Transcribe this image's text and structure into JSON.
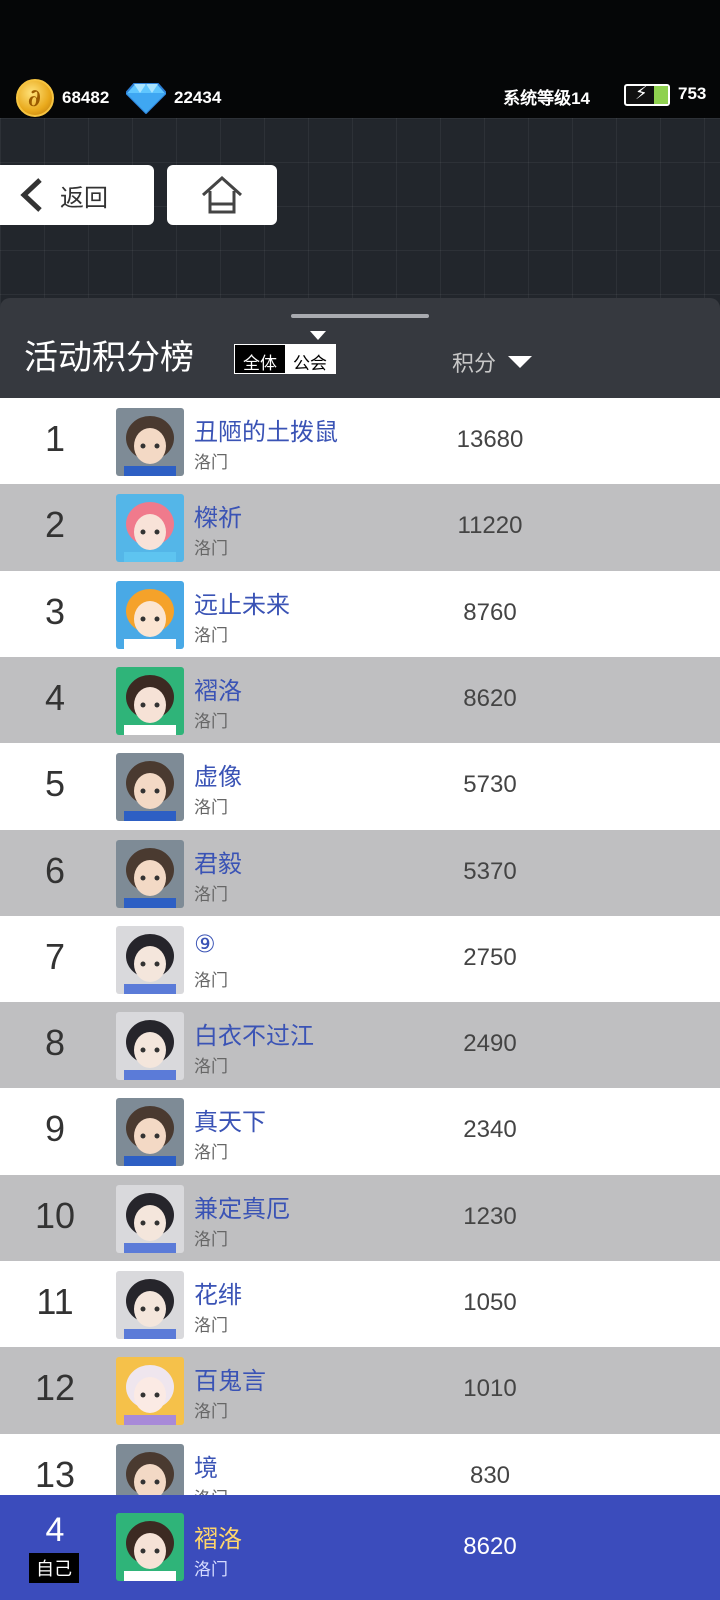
{
  "resources": {
    "coins": "68482",
    "gems": "22434",
    "system_level": "系统等级14",
    "stamina": "753"
  },
  "nav": {
    "back_label": "返回"
  },
  "board": {
    "title": "活动积分榜",
    "filter_all": "全体",
    "filter_guild": "公会",
    "score_header": "积分"
  },
  "rows": [
    {
      "rank": "1",
      "name": "丑陋的土拨鼠",
      "guild": "洛门",
      "score": "13680",
      "avatar": "boy"
    },
    {
      "rank": "2",
      "name": "榤祈",
      "guild": "洛门",
      "score": "11220",
      "avatar": "pink"
    },
    {
      "rank": "3",
      "name": "远止未来",
      "guild": "洛门",
      "score": "8760",
      "avatar": "orange"
    },
    {
      "rank": "4",
      "name": "褶洛",
      "guild": "洛门",
      "score": "8620",
      "avatar": "green"
    },
    {
      "rank": "5",
      "name": "虚像",
      "guild": "洛门",
      "score": "5730",
      "avatar": "boy"
    },
    {
      "rank": "6",
      "name": "君毅",
      "guild": "洛门",
      "score": "5370",
      "avatar": "boy"
    },
    {
      "rank": "7",
      "name": "⑨",
      "guild": "洛门",
      "score": "2750",
      "avatar": "dark"
    },
    {
      "rank": "8",
      "name": "白衣不过江",
      "guild": "洛门",
      "score": "2490",
      "avatar": "dark"
    },
    {
      "rank": "9",
      "name": "真天下",
      "guild": "洛门",
      "score": "2340",
      "avatar": "boy"
    },
    {
      "rank": "10",
      "name": "兼定真厄",
      "guild": "洛门",
      "score": "1230",
      "avatar": "dark"
    },
    {
      "rank": "11",
      "name": "花绯",
      "guild": "洛门",
      "score": "1050",
      "avatar": "dark"
    },
    {
      "rank": "12",
      "name": "百鬼言",
      "guild": "洛门",
      "score": "1010",
      "avatar": "white"
    },
    {
      "rank": "13",
      "name": "境",
      "guild": "洛门",
      "score": "830",
      "avatar": "boy"
    }
  ],
  "self": {
    "rank": "4",
    "tag": "自己",
    "name": "褶洛",
    "guild": "洛门",
    "score": "8620",
    "avatar": "green"
  },
  "colors": {
    "name_blue": "#3a53b5",
    "self_bar": "#3b4cbc",
    "row_alt": "#bfbfc1"
  }
}
